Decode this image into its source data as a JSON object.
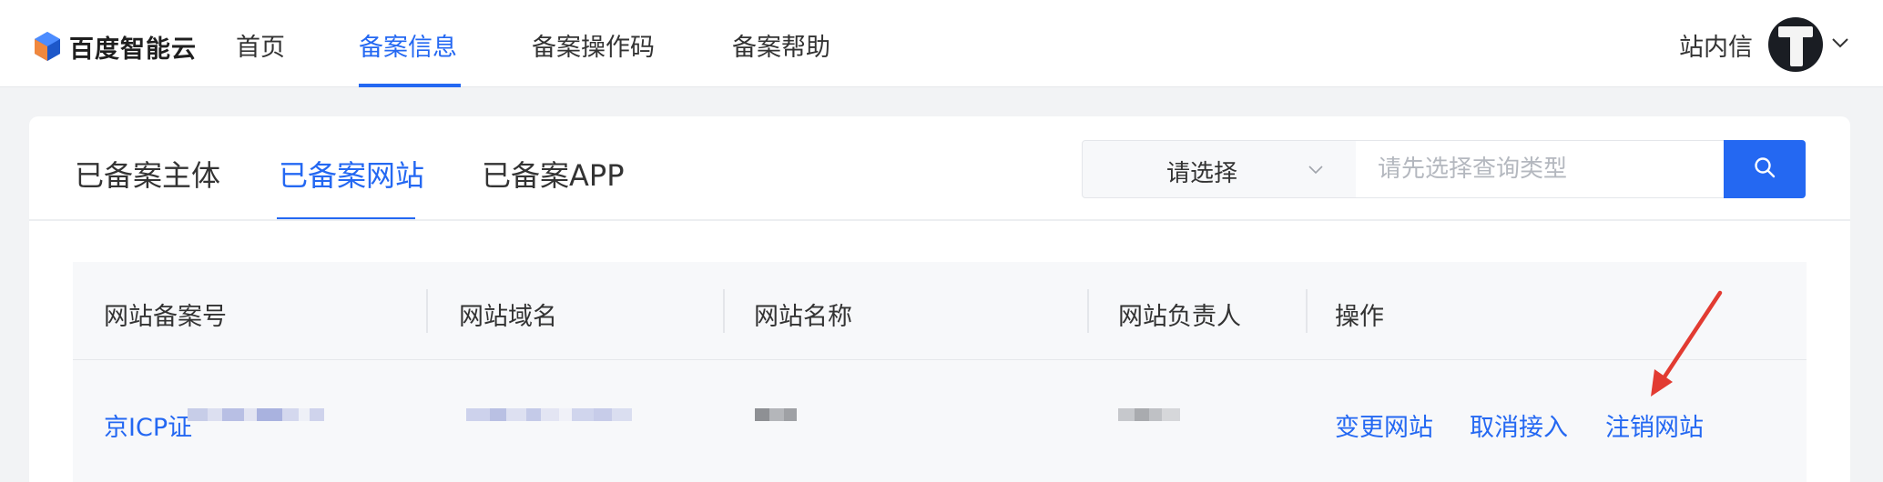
{
  "brand": {
    "name": "百度智能云"
  },
  "nav": {
    "items": [
      {
        "label": "首页"
      },
      {
        "label": "备案信息"
      },
      {
        "label": "备案操作码"
      },
      {
        "label": "备案帮助"
      }
    ],
    "active_index": 1,
    "message_label": "站内信"
  },
  "tabs": [
    {
      "label": "已备案主体"
    },
    {
      "label": "已备案网站"
    },
    {
      "label": "已备案APP"
    }
  ],
  "active_tab": 1,
  "search": {
    "select_value": "请选择",
    "placeholder": "请先选择查询类型"
  },
  "table": {
    "columns": [
      "网站备案号",
      "网站域名",
      "网站名称",
      "网站负责人",
      "操作"
    ],
    "rows": [
      {
        "record_prefix": "京ICP证",
        "actions": [
          "变更网站",
          "取消接入",
          "注销网站"
        ]
      }
    ]
  },
  "icons": [
    "brand-logo-icon",
    "chevron-down-icon",
    "search-icon",
    "annotation-arrow-icon"
  ],
  "colors": {
    "accent": "#2468f2",
    "annotation": "#e23b32"
  }
}
